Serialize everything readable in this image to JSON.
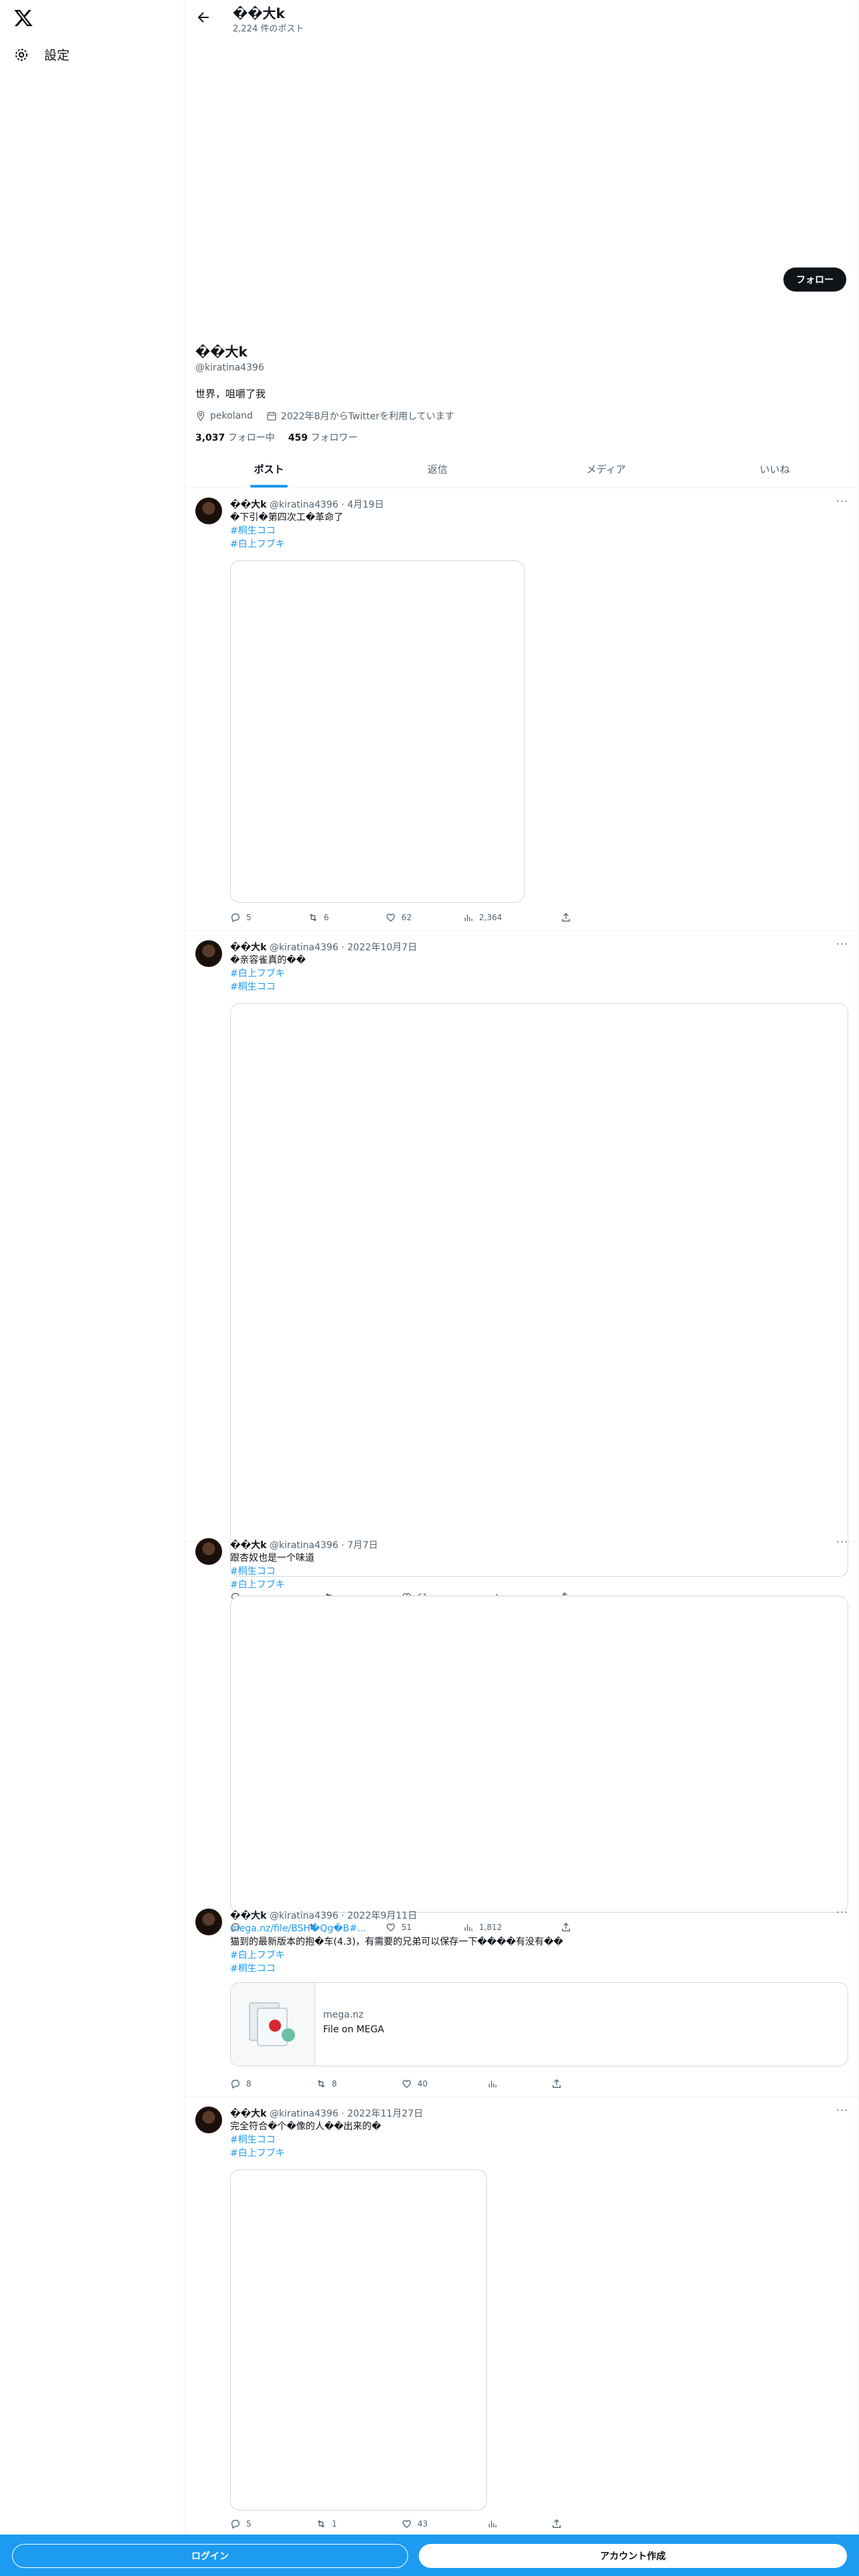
{
  "sidebar": {
    "logo": "x-logo",
    "settings_label": "設定"
  },
  "header": {
    "name": "��大k",
    "post_count": "2,224 件のポスト"
  },
  "profile": {
    "follow_button": "フォロー",
    "name": "��大k",
    "handle": "@kiratina4396",
    "bio": "世界，咀嚼了我",
    "location": "pekoland",
    "joined": "2022年8月からTwitterを利用しています",
    "following_count": "3,037",
    "following_label": "フォロー中",
    "followers_count": "459",
    "followers_label": "フォロワー"
  },
  "tabs": [
    "ポスト",
    "返信",
    "メディア",
    "いいね"
  ],
  "posts": [
    {
      "name": "��大k",
      "handle": "@kiratina4396",
      "date": "4月19日",
      "text": "�下引�第四次工�革命了",
      "tags": [
        "#桐生ココ",
        "#白上フブキ"
      ],
      "replies": "5",
      "reposts": "6",
      "likes": "62",
      "views": "2,364"
    },
    {
      "name": "��大k",
      "handle": "@kiratina4396",
      "date": "2022年10月7日",
      "text": "�亲容雀真的��",
      "tags": [
        "#白上フブキ",
        "#桐生ココ"
      ],
      "replies": "",
      "reposts": "",
      "likes": "",
      "views": ""
    },
    {
      "name": "��大k",
      "handle": "@kiratina4396",
      "date": "7月7日",
      "text": "跟杏奴也是一个味道",
      "tags": [
        "#桐生ココ",
        "#白上フブキ"
      ],
      "replies": "",
      "reposts": "",
      "likes": "61",
      "views": ""
    },
    {
      "name": "��大k",
      "handle": "@kiratina4396",
      "date": "2022年9月11日",
      "link": "mega.nz/file/BSH�Qg�B#...",
      "text": "猫到的最新版本的抱�车(4.3)，有需要的兄弟可以保存一下����有没有��",
      "tags": [
        "#白上フブキ",
        "#桐生ココ"
      ],
      "card_domain": "mega.nz",
      "card_title": "File on MEGA",
      "replies": "8",
      "reposts": "8",
      "likes": "40",
      "views": ""
    },
    {
      "name": "��大k",
      "handle": "@kiratina4396",
      "date": "2022年11月27日",
      "text": "完全符合�个�像的人��出来的�",
      "tags": [
        "#桐生ココ",
        "#白上フブキ"
      ],
      "replies": "5",
      "reposts": "1",
      "likes": "43",
      "views": ""
    }
  ],
  "overlap_actions": {
    "likes": "51",
    "views": "1,812"
  },
  "bottom_bar": {
    "login": "ログイン",
    "signup": "アカウント作成"
  },
  "colors": {
    "accent": "#1d9bf0",
    "text": "#0f1419",
    "muted": "#536471",
    "border": "#eff3f4"
  }
}
